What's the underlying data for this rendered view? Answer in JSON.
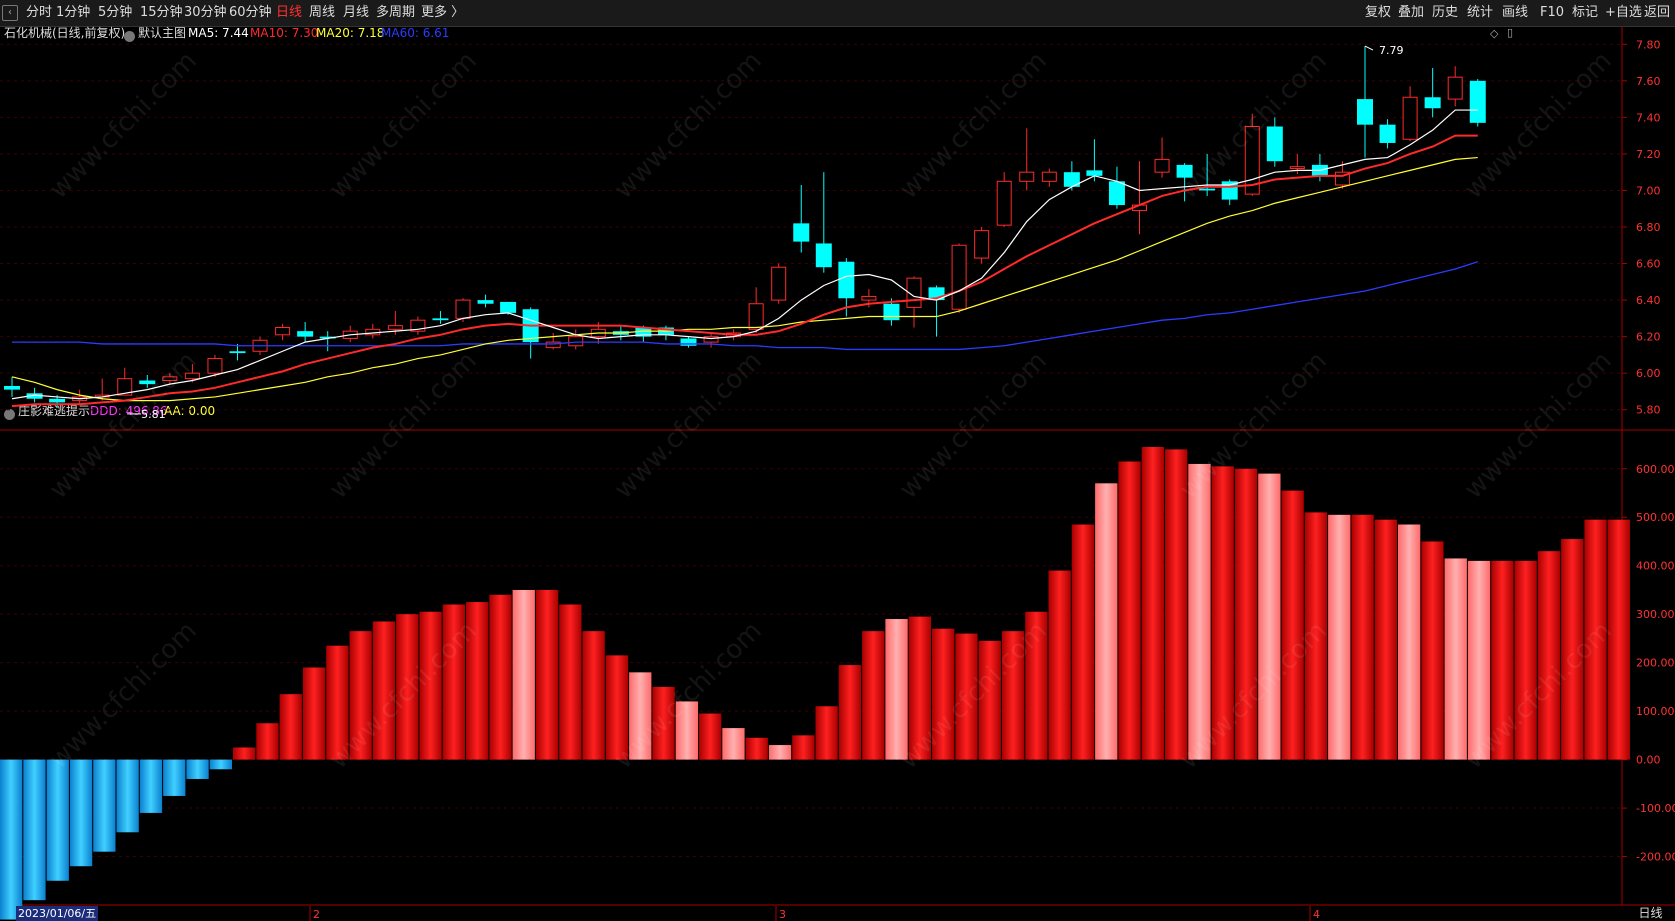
{
  "toolbar": {
    "left_items": [
      "分时",
      "1分钟",
      "5分钟",
      "15分钟",
      "30分钟",
      "60分钟",
      "日线",
      "周线",
      "月线",
      "多周期",
      "更多 〉"
    ],
    "active": "日线",
    "right_items": [
      "复权",
      "叠加",
      "历史",
      "统计",
      "画线",
      "F10",
      "标记",
      "+自选",
      "返回"
    ]
  },
  "main_panel": {
    "title": "石化机械(日线,前复权)",
    "template": "默认主图",
    "ma": [
      {
        "label": "MA5: 7.44",
        "color": "#ffffff"
      },
      {
        "label": "MA10: 7.30",
        "color": "#ff2a2a"
      },
      {
        "label": "MA20: 7.18",
        "color": "#ffff33"
      },
      {
        "label": "MA60: 6.61",
        "color": "#2a3cff"
      }
    ],
    "y_ticks": [
      "7.80",
      "7.60",
      "7.40",
      "7.20",
      "7.00",
      "6.80",
      "6.60",
      "6.40",
      "6.20",
      "6.00",
      "5.80"
    ],
    "high_marker": "7.79",
    "low_marker": "5.81"
  },
  "sub_panel": {
    "title": "庄影难逃提示",
    "ddd_label": "DDD: 496.86",
    "aa_label": "AA: 0.00",
    "ddd_color": "#ff33ff",
    "aa_color": "#ffff33",
    "y_ticks": [
      "600.00",
      "500.00",
      "400.00",
      "300.00",
      "200.00",
      "100.00",
      "0.00",
      "-100.00",
      "-200.00"
    ]
  },
  "bottom": {
    "date": "2023/01/06/五",
    "month_marks": [
      "2",
      "3",
      "4"
    ],
    "period": "日线"
  },
  "watermark": "www.cfchi.com",
  "colors": {
    "up": "#ff2a2a",
    "down": "#00ffff",
    "bar_red": "#ff1a1a",
    "bar_pink": "#ff9999",
    "bar_blue": "#19b8ff"
  },
  "chart_data": [
    {
      "type": "candlestick",
      "title": "石化机械(日线,前复权)",
      "ylim": [
        5.7,
        7.9
      ],
      "candles": [
        {
          "o": 5.93,
          "c": 5.91,
          "h": 5.98,
          "l": 5.87
        },
        {
          "o": 5.89,
          "c": 5.86,
          "h": 5.92,
          "l": 5.84
        },
        {
          "o": 5.86,
          "c": 5.84,
          "h": 5.88,
          "l": 5.81
        },
        {
          "o": 5.85,
          "c": 5.87,
          "h": 5.91,
          "l": 5.83
        },
        {
          "o": 5.87,
          "c": 5.88,
          "h": 5.97,
          "l": 5.85
        },
        {
          "o": 5.88,
          "c": 5.97,
          "h": 6.03,
          "l": 5.88
        },
        {
          "o": 5.96,
          "c": 5.94,
          "h": 5.99,
          "l": 5.92
        },
        {
          "o": 5.96,
          "c": 5.98,
          "h": 6.0,
          "l": 5.94
        },
        {
          "o": 5.97,
          "c": 6.0,
          "h": 6.05,
          "l": 5.95
        },
        {
          "o": 6.0,
          "c": 6.08,
          "h": 6.1,
          "l": 5.98
        },
        {
          "o": 6.12,
          "c": 6.11,
          "h": 6.16,
          "l": 6.07
        },
        {
          "o": 6.12,
          "c": 6.18,
          "h": 6.2,
          "l": 6.1
        },
        {
          "o": 6.21,
          "c": 6.25,
          "h": 6.27,
          "l": 6.18
        },
        {
          "o": 6.23,
          "c": 6.2,
          "h": 6.28,
          "l": 6.17
        },
        {
          "o": 6.2,
          "c": 6.19,
          "h": 6.23,
          "l": 6.12
        },
        {
          "o": 6.19,
          "c": 6.23,
          "h": 6.26,
          "l": 6.17
        },
        {
          "o": 6.21,
          "c": 6.24,
          "h": 6.27,
          "l": 6.19
        },
        {
          "o": 6.24,
          "c": 6.26,
          "h": 6.34,
          "l": 6.21
        },
        {
          "o": 6.23,
          "c": 6.29,
          "h": 6.31,
          "l": 6.21
        },
        {
          "o": 6.3,
          "c": 6.29,
          "h": 6.34,
          "l": 6.27
        },
        {
          "o": 6.3,
          "c": 6.4,
          "h": 6.41,
          "l": 6.28
        },
        {
          "o": 6.4,
          "c": 6.38,
          "h": 6.43,
          "l": 6.36
        },
        {
          "o": 6.39,
          "c": 6.33,
          "h": 6.39,
          "l": 6.32
        },
        {
          "o": 6.35,
          "c": 6.17,
          "h": 6.36,
          "l": 6.08
        },
        {
          "o": 6.14,
          "c": 6.17,
          "h": 6.22,
          "l": 6.13
        },
        {
          "o": 6.15,
          "c": 6.2,
          "h": 6.24,
          "l": 6.13
        },
        {
          "o": 6.2,
          "c": 6.24,
          "h": 6.28,
          "l": 6.16
        },
        {
          "o": 6.23,
          "c": 6.21,
          "h": 6.26,
          "l": 6.18
        },
        {
          "o": 6.25,
          "c": 6.2,
          "h": 6.26,
          "l": 6.17
        },
        {
          "o": 6.25,
          "c": 6.21,
          "h": 6.26,
          "l": 6.18
        },
        {
          "o": 6.19,
          "c": 6.15,
          "h": 6.2,
          "l": 6.14
        },
        {
          "o": 6.17,
          "c": 6.2,
          "h": 6.22,
          "l": 6.14
        },
        {
          "o": 6.2,
          "c": 6.22,
          "h": 6.24,
          "l": 6.18
        },
        {
          "o": 6.24,
          "c": 6.38,
          "h": 6.47,
          "l": 6.22
        },
        {
          "o": 6.4,
          "c": 6.58,
          "h": 6.6,
          "l": 6.38
        },
        {
          "o": 6.82,
          "c": 6.72,
          "h": 7.03,
          "l": 6.66
        },
        {
          "o": 6.71,
          "c": 6.58,
          "h": 7.1,
          "l": 6.55
        },
        {
          "o": 6.61,
          "c": 6.41,
          "h": 6.63,
          "l": 6.31
        },
        {
          "o": 6.4,
          "c": 6.42,
          "h": 6.46,
          "l": 6.36
        },
        {
          "o": 6.38,
          "c": 6.29,
          "h": 6.41,
          "l": 6.26
        },
        {
          "o": 6.36,
          "c": 6.52,
          "h": 6.53,
          "l": 6.25
        },
        {
          "o": 6.47,
          "c": 6.4,
          "h": 6.48,
          "l": 6.2
        },
        {
          "o": 6.35,
          "c": 6.7,
          "h": 6.71,
          "l": 6.33
        },
        {
          "o": 6.63,
          "c": 6.78,
          "h": 6.8,
          "l": 6.6
        },
        {
          "o": 6.81,
          "c": 7.05,
          "h": 7.1,
          "l": 6.8
        },
        {
          "o": 7.05,
          "c": 7.1,
          "h": 7.34,
          "l": 7.0
        },
        {
          "o": 7.05,
          "c": 7.1,
          "h": 7.12,
          "l": 7.02
        },
        {
          "o": 7.1,
          "c": 7.02,
          "h": 7.16,
          "l": 7.0
        },
        {
          "o": 7.11,
          "c": 7.08,
          "h": 7.28,
          "l": 7.05
        },
        {
          "o": 7.05,
          "c": 6.92,
          "h": 7.13,
          "l": 6.9
        },
        {
          "o": 6.89,
          "c": 6.92,
          "h": 7.16,
          "l": 6.76
        },
        {
          "o": 7.1,
          "c": 7.17,
          "h": 7.29,
          "l": 7.07
        },
        {
          "o": 7.14,
          "c": 7.07,
          "h": 7.15,
          "l": 6.94
        },
        {
          "o": 7.01,
          "c": 7.0,
          "h": 7.2,
          "l": 6.97
        },
        {
          "o": 7.05,
          "c": 6.95,
          "h": 7.06,
          "l": 6.92
        },
        {
          "o": 6.98,
          "c": 7.35,
          "h": 7.42,
          "l": 6.97
        },
        {
          "o": 7.35,
          "c": 7.16,
          "h": 7.4,
          "l": 7.13
        },
        {
          "o": 7.12,
          "c": 7.13,
          "h": 7.2,
          "l": 7.09
        },
        {
          "o": 7.14,
          "c": 7.08,
          "h": 7.2,
          "l": 7.05
        },
        {
          "o": 7.03,
          "c": 7.1,
          "h": 7.16,
          "l": 7.01
        },
        {
          "o": 7.5,
          "c": 7.36,
          "h": 7.79,
          "l": 7.18
        },
        {
          "o": 7.36,
          "c": 7.26,
          "h": 7.39,
          "l": 7.23
        },
        {
          "o": 7.28,
          "c": 7.51,
          "h": 7.57,
          "l": 7.27
        },
        {
          "o": 7.51,
          "c": 7.45,
          "h": 7.67,
          "l": 7.4
        },
        {
          "o": 7.5,
          "c": 7.62,
          "h": 7.68,
          "l": 7.46
        },
        {
          "o": 7.6,
          "c": 7.37,
          "h": 7.61,
          "l": 7.35
        }
      ],
      "ma5": [
        5.86,
        5.88,
        5.87,
        5.86,
        5.87,
        5.89,
        5.91,
        5.94,
        5.96,
        5.99,
        6.02,
        6.07,
        6.12,
        6.17,
        6.19,
        6.21,
        6.22,
        6.23,
        6.24,
        6.26,
        6.3,
        6.32,
        6.33,
        6.29,
        6.25,
        6.21,
        6.19,
        6.2,
        6.21,
        6.21,
        6.2,
        6.19,
        6.2,
        6.23,
        6.3,
        6.4,
        6.48,
        6.53,
        6.54,
        6.51,
        6.42,
        6.4,
        6.45,
        6.52,
        6.66,
        6.83,
        6.95,
        7.02,
        7.08,
        7.05,
        7.0,
        7.01,
        7.02,
        7.03,
        7.03,
        7.06,
        7.1,
        7.11,
        7.11,
        7.14,
        7.17,
        7.18,
        7.25,
        7.33,
        7.44,
        7.44
      ],
      "ma10": [
        5.82,
        5.83,
        5.83,
        5.83,
        5.84,
        5.85,
        5.87,
        5.89,
        5.9,
        5.92,
        5.95,
        5.98,
        6.01,
        6.05,
        6.08,
        6.11,
        6.14,
        6.16,
        6.19,
        6.21,
        6.24,
        6.26,
        6.27,
        6.26,
        6.26,
        6.26,
        6.26,
        6.26,
        6.25,
        6.24,
        6.23,
        6.22,
        6.21,
        6.21,
        6.23,
        6.27,
        6.32,
        6.36,
        6.38,
        6.39,
        6.4,
        6.41,
        6.45,
        6.5,
        6.57,
        6.64,
        6.7,
        6.76,
        6.82,
        6.87,
        6.92,
        6.97,
        7.0,
        7.02,
        7.02,
        7.03,
        7.06,
        7.07,
        7.08,
        7.08,
        7.12,
        7.15,
        7.2,
        7.24,
        7.3,
        7.3
      ],
      "ma20": [
        5.98,
        5.95,
        5.91,
        5.88,
        5.86,
        5.85,
        5.85,
        5.85,
        5.86,
        5.87,
        5.89,
        5.91,
        5.93,
        5.95,
        5.98,
        6.0,
        6.03,
        6.05,
        6.08,
        6.1,
        6.13,
        6.16,
        6.18,
        6.19,
        6.2,
        6.21,
        6.22,
        6.22,
        6.23,
        6.23,
        6.24,
        6.24,
        6.25,
        6.25,
        6.26,
        6.28,
        6.29,
        6.3,
        6.31,
        6.31,
        6.31,
        6.31,
        6.34,
        6.38,
        6.42,
        6.46,
        6.5,
        6.54,
        6.58,
        6.62,
        6.67,
        6.72,
        6.77,
        6.82,
        6.86,
        6.89,
        6.93,
        6.96,
        6.99,
        7.02,
        7.05,
        7.08,
        7.11,
        7.14,
        7.17,
        7.18
      ],
      "ma60": [
        6.17,
        6.17,
        6.17,
        6.17,
        6.16,
        6.16,
        6.16,
        6.16,
        6.16,
        6.16,
        6.15,
        6.15,
        6.15,
        6.15,
        6.15,
        6.15,
        6.15,
        6.15,
        6.15,
        6.15,
        6.16,
        6.16,
        6.16,
        6.16,
        6.16,
        6.17,
        6.17,
        6.17,
        6.17,
        6.16,
        6.16,
        6.16,
        6.15,
        6.15,
        6.14,
        6.14,
        6.14,
        6.13,
        6.13,
        6.13,
        6.13,
        6.13,
        6.13,
        6.14,
        6.15,
        6.17,
        6.19,
        6.21,
        6.23,
        6.25,
        6.27,
        6.29,
        6.3,
        6.32,
        6.33,
        6.35,
        6.37,
        6.39,
        6.41,
        6.43,
        6.45,
        6.48,
        6.51,
        6.54,
        6.57,
        6.61
      ]
    },
    {
      "type": "bar",
      "title": "庄影难逃提示",
      "ylim": [
        -300,
        680
      ],
      "series": [
        {
          "name": "DDD",
          "values": [
            -330,
            -290,
            -250,
            -220,
            -190,
            -150,
            -110,
            -75,
            -40,
            -20,
            25,
            75,
            135,
            190,
            235,
            265,
            285,
            300,
            305,
            320,
            325,
            340,
            350,
            350,
            320,
            265,
            215,
            180,
            150,
            120,
            95,
            65,
            45,
            30,
            50,
            110,
            195,
            265,
            290,
            295,
            270,
            260,
            245,
            265,
            305,
            390,
            485,
            570,
            615,
            645,
            640,
            610,
            605,
            600,
            590,
            555,
            510,
            505,
            505,
            495,
            485,
            450,
            415,
            410,
            410,
            410,
            430,
            455,
            495,
            495
          ]
        }
      ],
      "pink_bars": [
        22,
        27,
        29,
        31,
        33,
        38,
        47,
        51,
        54,
        57,
        60,
        62,
        63
      ]
    }
  ]
}
